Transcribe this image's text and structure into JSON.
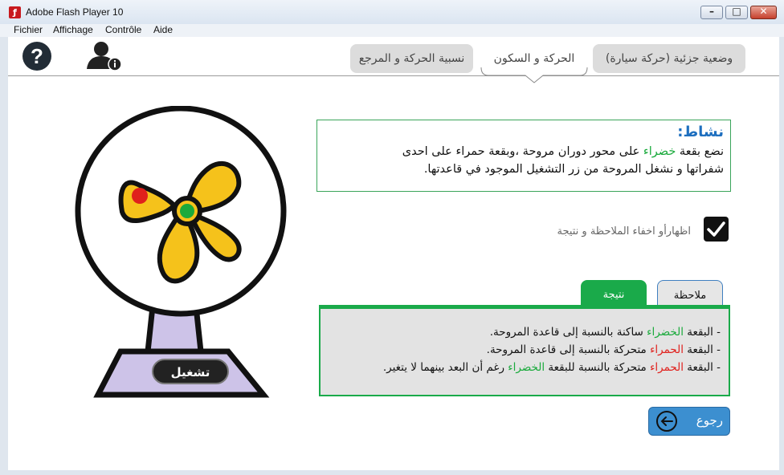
{
  "window": {
    "title": "Adobe Flash Player 10",
    "min": "0",
    "max": "1",
    "close": "r"
  },
  "menu": [
    "Fichier",
    "Affichage",
    "Contrôle",
    "Aide"
  ],
  "toolbar": {
    "help_glyph": "?"
  },
  "tabs": [
    {
      "label": "وضعية جزئية (حركة سيارة)",
      "active": false
    },
    {
      "label": "الحركة و السكون",
      "active": true
    },
    {
      "label": "نسبية الحركة و المرجع",
      "active": false
    }
  ],
  "activity": {
    "title": "نشاط:",
    "line1_a": "نضع بقعة ",
    "line1_green": "خضراء",
    "line1_b": " على محور دوران مروحة ،وبقعة حمراء على احدى",
    "line2": "شفراتها و نشغل المروحة من زر التشغيل الموجود في قاعدتها."
  },
  "toggle": {
    "label": "اظهارأو اخفاء الملاحظة و نتيجة",
    "checked": true
  },
  "subtabs": {
    "note": "ملاحظة",
    "result": "نتيجة"
  },
  "results": [
    {
      "a": "- البقعة ",
      "color_word": "الخضراء",
      "color": "green",
      "b": " ساكنة بالنسبة إلى قاعدة المروحة."
    },
    {
      "a": "- البقعة ",
      "color_word": "الحمراء",
      "color": "red",
      "b": " متحركة بالنسبة إلى قاعدة المروحة."
    },
    {
      "a": "- البقعة ",
      "color_word": "الحمراء",
      "color": "red",
      "b": " متحركة بالنسبة للبقعة ",
      "color_word2": "الخضراء",
      "c": " رغم أن البعد بينهما لا يتغير."
    }
  ],
  "fan": {
    "run_label": "تشغيل"
  },
  "back": {
    "label": "رجوع"
  },
  "colors": {
    "green": "#1aaa3c",
    "red": "#e0201c",
    "blue": "#1e6fbf",
    "blade": "#f5c21b",
    "base": "#cdc3e8"
  }
}
